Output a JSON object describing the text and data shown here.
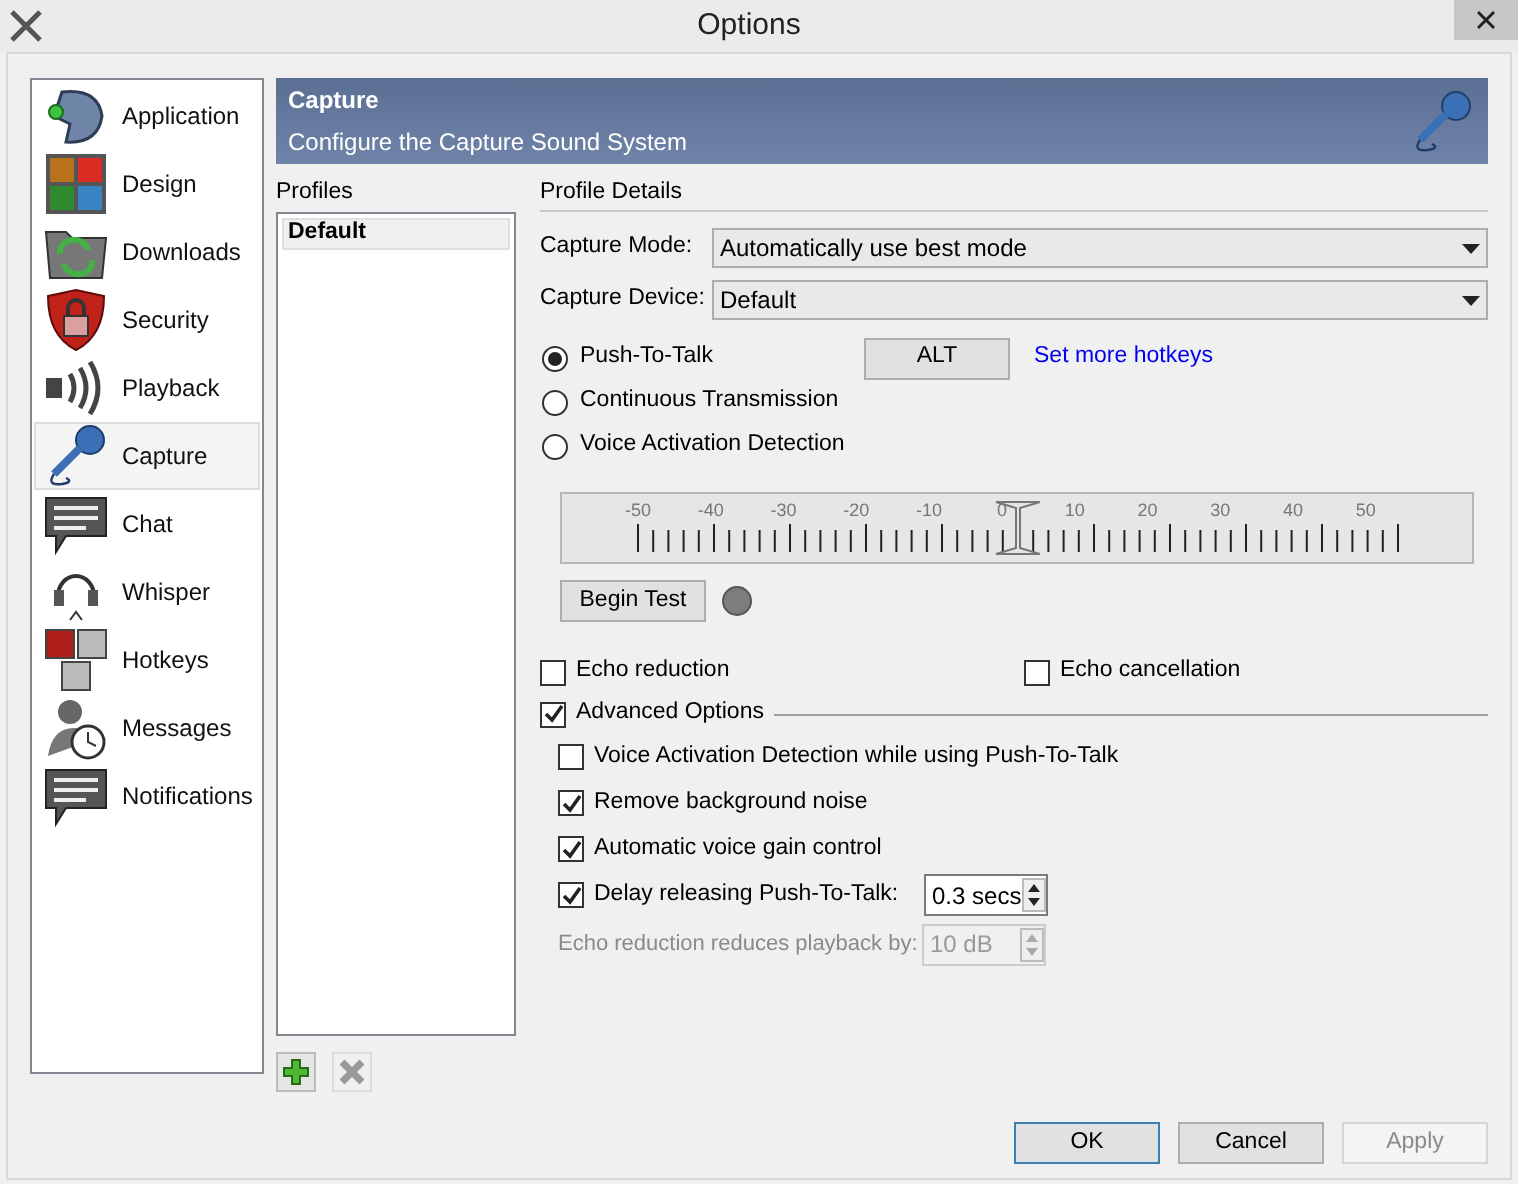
{
  "window": {
    "title": "Options"
  },
  "sidebar": {
    "items": [
      {
        "label": "Application",
        "selected": false
      },
      {
        "label": "Design",
        "selected": false
      },
      {
        "label": "Downloads",
        "selected": false
      },
      {
        "label": "Security",
        "selected": false
      },
      {
        "label": "Playback",
        "selected": false
      },
      {
        "label": "Capture",
        "selected": true
      },
      {
        "label": "Chat",
        "selected": false
      },
      {
        "label": "Whisper",
        "selected": false
      },
      {
        "label": "Hotkeys",
        "selected": false
      },
      {
        "label": "Messages",
        "selected": false
      },
      {
        "label": "Notifications",
        "selected": false
      }
    ]
  },
  "header": {
    "title": "Capture",
    "subtitle": "Configure the Capture Sound System"
  },
  "profiles": {
    "label": "Profiles",
    "items": [
      {
        "label": "Default",
        "selected": true
      }
    ]
  },
  "details": {
    "label": "Profile Details",
    "capture_mode": {
      "label": "Capture Mode:",
      "value": "Automatically use best mode"
    },
    "capture_device": {
      "label": "Capture Device:",
      "value": "Default"
    },
    "modes": [
      {
        "label": "Push-To-Talk",
        "selected": true
      },
      {
        "label": "Continuous Transmission",
        "selected": false
      },
      {
        "label": "Voice Activation Detection",
        "selected": false
      }
    ],
    "hotkey": "ALT",
    "more_hotkeys": "Set more hotkeys",
    "threshold": {
      "ticks": [
        "-50",
        "-40",
        "-30",
        "-20",
        "-10",
        "0",
        "10",
        "20",
        "30",
        "40",
        "50"
      ],
      "level": 0.5
    },
    "begin_test": "Begin Test",
    "echo": [
      {
        "label": "Echo reduction",
        "checked": false
      },
      {
        "label": "Echo cancellation",
        "checked": false
      }
    ],
    "advanced": {
      "label": "Advanced Options",
      "checked": true
    },
    "advanced_options": [
      {
        "label": "Voice Activation Detection while using Push-To-Talk",
        "checked": false
      },
      {
        "label": "Remove background noise",
        "checked": true
      },
      {
        "label": "Automatic voice gain control",
        "checked": true
      },
      {
        "label": "Delay releasing Push-To-Talk:",
        "checked": true,
        "value": "0.3 secs"
      }
    ],
    "echo_reduction": {
      "label": "Echo reduction reduces playback by:",
      "value": "10 dB",
      "disabled": true
    }
  },
  "buttons": [
    {
      "label": "OK",
      "kind": "default",
      "disabled": false
    },
    {
      "label": "Cancel",
      "kind": "normal",
      "disabled": false
    },
    {
      "label": "Apply",
      "kind": "normal",
      "disabled": true
    }
  ]
}
